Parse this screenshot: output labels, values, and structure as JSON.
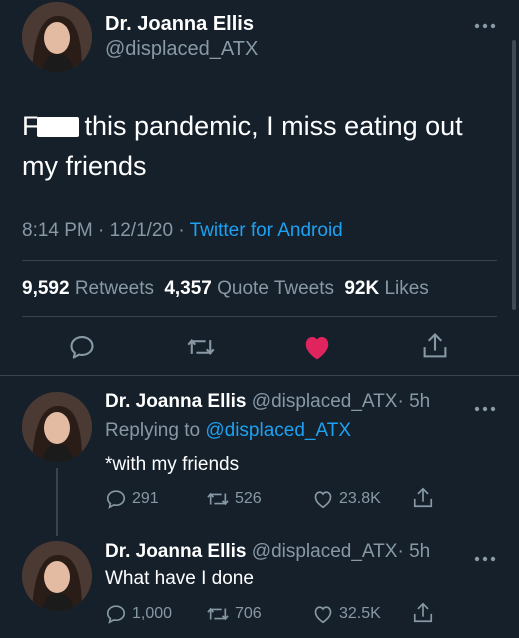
{
  "main_tweet": {
    "author_name": "Dr. Joanna Ellis",
    "author_handle": "@displaced_ATX",
    "text_prefix": "F",
    "text_after_censor": "this pandemic, I miss eating out",
    "text_line2": "my friends",
    "time": "8:14 PM",
    "date": "12/1/20",
    "sep": "·",
    "source": "Twitter for Android",
    "retweets_count": "9,592",
    "retweets_label": "Retweets",
    "quotes_count": "4,357",
    "quotes_label": "Quote Tweets",
    "likes_count": "92K",
    "likes_label": "Likes"
  },
  "replies": [
    {
      "author_name": "Dr. Joanna Ellis",
      "author_handle": "@displaced_ATX",
      "age": "· 5h",
      "replying_prefix": "Replying to",
      "replying_to": "@displaced_ATX",
      "text": "*with my friends",
      "replies": "291",
      "retweets": "526",
      "likes": "23.8K"
    },
    {
      "author_name": "Dr. Joanna Ellis",
      "author_handle": "@displaced_ATX",
      "age": "· 5h",
      "text": "What have I done",
      "replies": "1,000",
      "retweets": "706",
      "likes": "32.5K"
    }
  ],
  "colors": {
    "background": "#15202b",
    "accent": "#1da1f2",
    "like": "#e0245e",
    "muted": "#8899a6",
    "divider": "#38444d"
  },
  "icons": [
    "more-icon",
    "reply-icon",
    "retweet-icon",
    "heart-icon",
    "share-icon"
  ]
}
